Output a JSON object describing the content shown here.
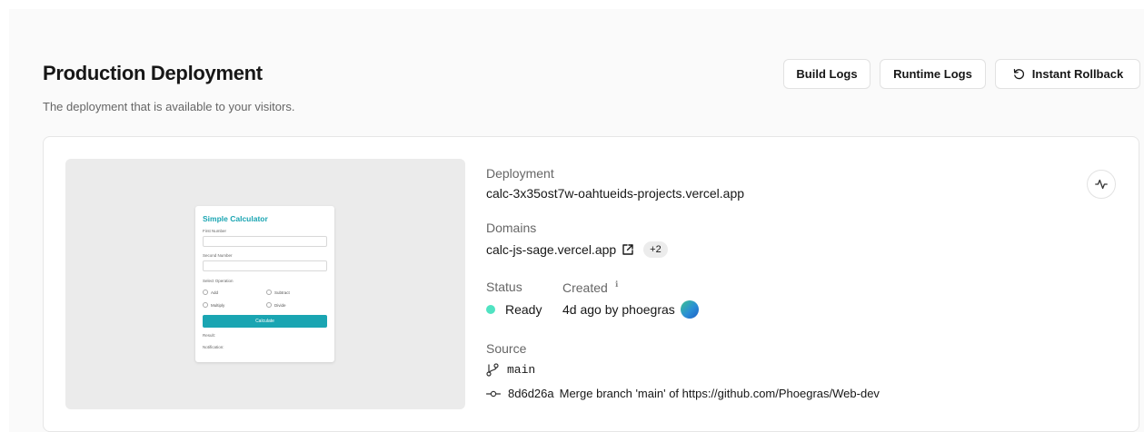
{
  "header": {
    "title": "Production Deployment",
    "subtitle": "The deployment that is available to your visitors.",
    "buttons": {
      "build_logs": "Build Logs",
      "runtime_logs": "Runtime Logs",
      "instant_rollback": "Instant Rollback",
      "rollback_icon": "rotate-ccw-icon"
    }
  },
  "preview": {
    "title": "Simple Calculator",
    "first_number_label": "First Number",
    "second_number_label": "Second Number",
    "operation_label": "Select Operation",
    "options": [
      "Add",
      "Subtract",
      "Multiply",
      "Divide"
    ],
    "calculate_label": "Calculate",
    "result_label": "Result:",
    "notification_label": "Notification:",
    "accent_color": "#1aa5b2"
  },
  "details": {
    "deployment_label": "Deployment",
    "deployment_url": "calc-3x35ost7w-oahtueids-projects.vercel.app",
    "domains_label": "Domains",
    "domain": "calc-js-sage.vercel.app",
    "domains_extra": "+2",
    "status_label": "Status",
    "status_value": "Ready",
    "status_color": "#50e3c2",
    "created_label": "Created",
    "created_value": "4d ago by phoegras",
    "source_label": "Source",
    "branch": "main",
    "commit_hash": "8d6d26a",
    "commit_message": "Merge branch 'main' of https://github.com/Phoegras/Web-dev"
  }
}
